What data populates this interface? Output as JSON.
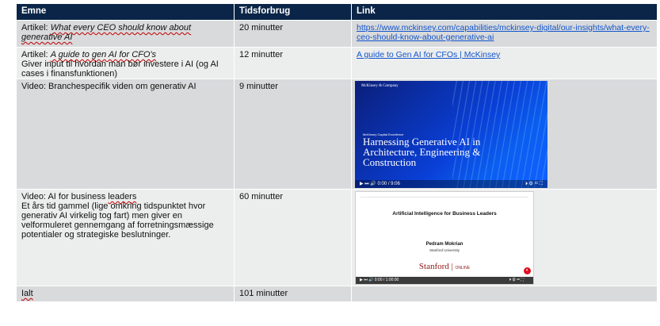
{
  "table": {
    "headers": {
      "topic": "Emne",
      "time": "Tidsforbrug",
      "link": "Link"
    },
    "rows": [
      {
        "topic_prefix": "Artikel: ",
        "topic_italic": "What every CEO should know about generative AI",
        "time": "20 minutter",
        "link_text": "https://www.mckinsey.com/capabilities/mckinsey-digital/our-insights/what-every-ceo-should-know-about-generative-ai"
      },
      {
        "topic_prefix": "Artikel: ",
        "topic_italic": "A guide to gen AI for CFO's",
        "topic_extra": "Giver input til hvordan man bør investere i AI (og AI cases i finansfunktionen)",
        "time": "12 minutter",
        "link_text": "A guide to Gen AI for CFOs | McKinsey"
      },
      {
        "topic": "Video: Branchespecifik viden om generativ AI",
        "time": "9 minutter",
        "video": {
          "brand": "McKinsey & Company",
          "kicker": "McKinsey Capital Excellence",
          "title": "Harnessing Generative AI in Architecture, Engineering & Construction",
          "time_readout": "0:00 / 9:06"
        }
      },
      {
        "topic_prefix": "Video: AI for business ",
        "topic_squig": "leaders",
        "topic_extra": "Et års tid gammel (lige omkring tidspunktet hvor generativ AI virkelig tog fart) men giver en velformuleret gennemgang af forretningsmæssige potentialer og strategiske beslutninger.",
        "time": "60 minutter",
        "video": {
          "title": "Artificial Intelligence for Business Leaders",
          "presenter": "Pedram Mokrian",
          "affiliation": "Stanford University",
          "brand": "Stanford",
          "brand_suffix": "ONLINE",
          "time_readout": "0:00 / 1:00:00"
        }
      },
      {
        "topic": "Ialt",
        "time": "101 minutter"
      }
    ]
  },
  "colors": {
    "header_bg": "#0a2547",
    "row_dark": "#d9dadc",
    "row_light": "#eceded",
    "link": "#1155cc"
  }
}
